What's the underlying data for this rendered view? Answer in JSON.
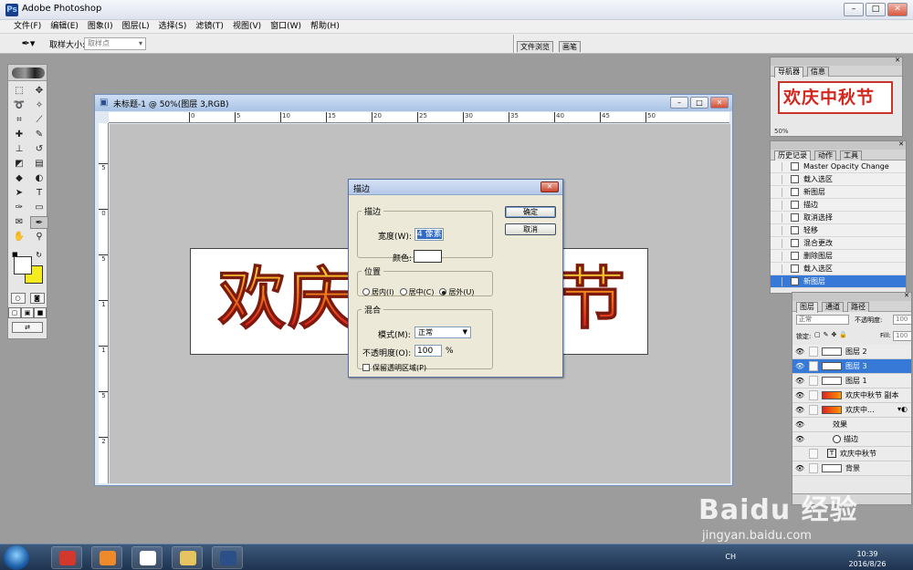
{
  "app": {
    "title": "Adobe Photoshop",
    "icon_text": "Ps"
  },
  "menubar": [
    "文件(F)",
    "编辑(E)",
    "图象(I)",
    "图层(L)",
    "选择(S)",
    "滤镜(T)",
    "视图(V)",
    "窗口(W)",
    "帮助(H)"
  ],
  "options": {
    "sample_label": "取样大小:",
    "sample_value": "取样点",
    "well_tabs": [
      "文件浏览",
      "画笔"
    ]
  },
  "document": {
    "title": "未标题-1 @ 50%(图层 3,RGB)",
    "artwork_text_left": "欢庆",
    "artwork_text_right": "节",
    "ruler_top": [
      "0",
      "5",
      "10",
      "15",
      "20",
      "25",
      "30",
      "35",
      "40",
      "45",
      "50"
    ],
    "ruler_left": [
      "5",
      "0",
      "5",
      "1",
      "1",
      "5",
      "2"
    ]
  },
  "stroke_dialog": {
    "title": "描边",
    "stroke_group": "描边",
    "width_label": "宽度(W):",
    "width_value": "4 像素",
    "color_label": "颜色:",
    "location_group": "位置",
    "location_inside": "居内(I)",
    "location_center": "居中(C)",
    "location_outside": "居外(U)",
    "blend_group": "混合",
    "mode_label": "模式(M):",
    "mode_value": "正常",
    "opacity_label": "不透明度(O):",
    "opacity_value": "100",
    "opacity_unit": "%",
    "preserve_label": "保留透明区域(P)",
    "ok": "确定",
    "cancel": "取消"
  },
  "navigator": {
    "tabs": [
      "导航器",
      "信息"
    ],
    "preview_text": "欢庆中秋节",
    "zoom": "50%"
  },
  "history": {
    "tabs": [
      "历史记录",
      "动作",
      "工具"
    ],
    "items": [
      "Master Opacity Change",
      "载入选区",
      "新图层",
      "描边",
      "取消选择",
      "轻移",
      "混合更改",
      "删除图层",
      "载入选区",
      "新图层"
    ]
  },
  "layers": {
    "tabs": [
      "图层",
      "通道",
      "路径"
    ],
    "blend_mode": "正常",
    "opacity_label": "不透明度:",
    "opacity_value": "100",
    "lock_label": "锁定:",
    "fill_label": "Fill:",
    "fill_value": "100",
    "items": [
      {
        "name": "图层 2"
      },
      {
        "name": "图层 3"
      },
      {
        "name": "图层 1"
      },
      {
        "name": "欢庆中秋节 副本"
      },
      {
        "name": "欢庆中..."
      },
      {
        "name": "效果"
      },
      {
        "name": "描边"
      },
      {
        "name": "欢庆中秋节"
      },
      {
        "name": "背景"
      }
    ]
  },
  "taskbar": {
    "lang": "CH",
    "time": "10:39",
    "date": "2016/8/26"
  },
  "watermark": {
    "main": "Baidu 经验",
    "sub": "jingyan.baidu.com"
  },
  "colors": {
    "foreground": "#ffffff",
    "background": "#f4ec1e",
    "selection": "#3679d6"
  }
}
